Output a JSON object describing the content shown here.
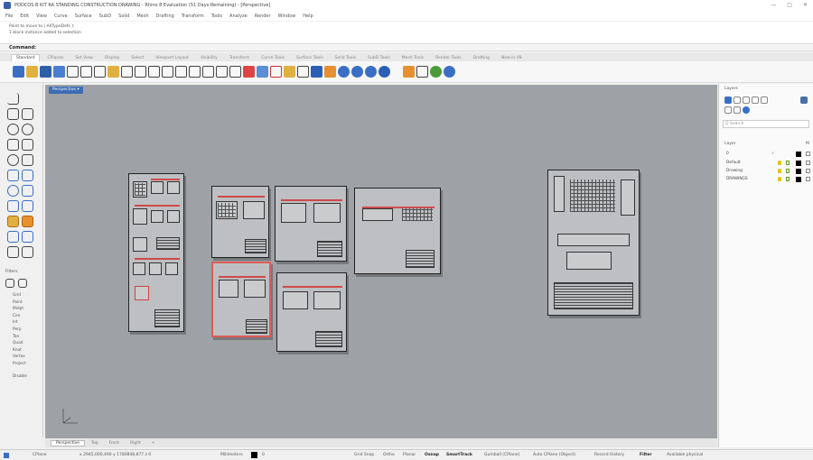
{
  "window": {
    "title": "PODCOS B KIT RA STANDING CONSTRUCTION DRAWING - Rhino 8 Evaluation (51 Days Remaining) - [Perspective]",
    "controls": [
      "—",
      "□",
      "✕"
    ]
  },
  "menu": [
    "File",
    "Edit",
    "View",
    "Curve",
    "Surface",
    "SubD",
    "Solid",
    "Mesh",
    "Drafting",
    "Transform",
    "Tools",
    "Analyze",
    "Render",
    "Window",
    "Help"
  ],
  "command_history": [
    "Point to move to ( AllTypeDefs ):",
    "1 block instance added to selection"
  ],
  "command_prompt": "Command:",
  "toolbar_tabs": [
    "Standard",
    "CPlanes",
    "Set View",
    "Display",
    "Select",
    "Viewport Layout",
    "Visibility",
    "Transform",
    "Curve Tools",
    "Surface Tools",
    "Solid Tools",
    "SubD Tools",
    "Mesh Tools",
    "Render Tools",
    "Drafting",
    "New in V8"
  ],
  "active_toolbar_tab": "Standard",
  "left_toolbar": {
    "filter_label": "Filters",
    "items": [
      "Grid",
      "Point",
      "Midpt",
      "Cen",
      "Int",
      "Perp",
      "Tan",
      "Quad",
      "Knot",
      "Vertex",
      "Project"
    ],
    "disable_label": "Disable"
  },
  "viewport": {
    "title": "Perspective ▾",
    "background": "#9ea2a6"
  },
  "viewport_tabs": [
    "Perspective",
    "Top",
    "Front",
    "Right",
    "+"
  ],
  "active_viewport_tab": "Perspective",
  "layers_panel": {
    "title": "Layers",
    "search_placeholder": "Q Search",
    "column_header": "Layer",
    "column_header_m": "M",
    "default_layer": "0",
    "layers": [
      "Default",
      "Drawing",
      "DRAWINGS"
    ]
  },
  "statusbar": {
    "cplane": "CPlane",
    "coords": "x 2945,000,490  y 1780848,877  z 0",
    "units": "Millimeters",
    "layer": "0",
    "toggles": [
      "Grid Snap",
      "Ortho",
      "Planar",
      "Osnap",
      "SmartTrack",
      "Gumball (CPlane)",
      "Auto CPlane (Object)",
      "Record History",
      "Filter",
      "Available physical"
    ],
    "active_toggles": [
      "Osnap",
      "SmartTrack",
      "Filter"
    ]
  }
}
